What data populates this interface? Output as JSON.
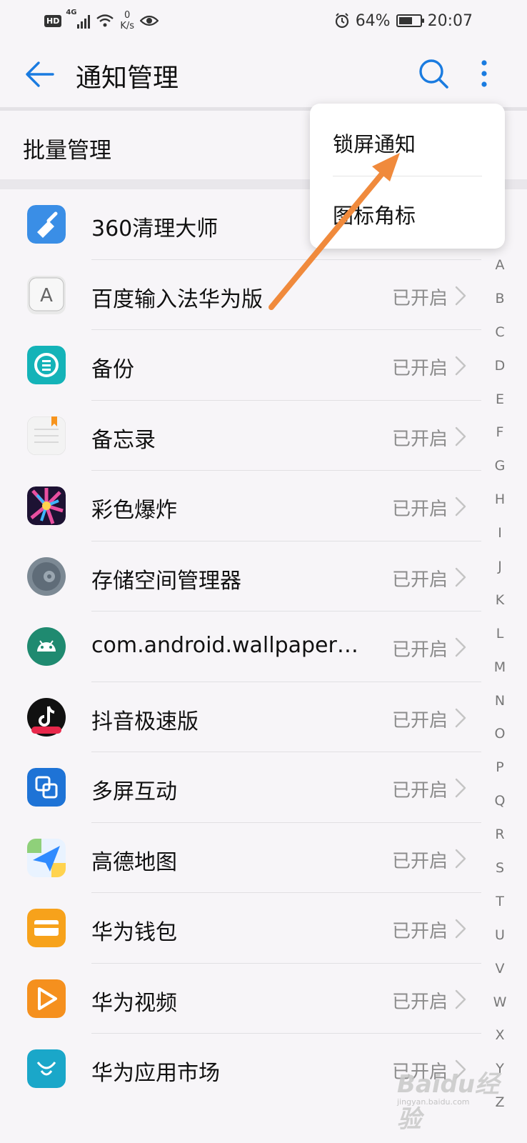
{
  "status_bar": {
    "hd": "HD",
    "network": "4G",
    "speed_value": "0",
    "speed_unit": "K/s",
    "battery_percent": "64%",
    "battery_level": 0.64,
    "time": "20:07"
  },
  "header": {
    "title": "通知管理"
  },
  "batch_label": "批量管理",
  "popup_menu": {
    "items": [
      "锁屏通知",
      "图标角标"
    ]
  },
  "apps": [
    {
      "name": "360清理大师",
      "status": "",
      "icon": "broom-icon",
      "color": "#3a8ee6"
    },
    {
      "name": "百度输入法华为版",
      "status": "已开启",
      "icon": "keyboard-a-icon",
      "color": "#d6d6d6"
    },
    {
      "name": "备份",
      "status": "已开启",
      "icon": "backup-icon",
      "color": "#14b3b8"
    },
    {
      "name": "备忘录",
      "status": "已开启",
      "icon": "notepad-icon",
      "color": "#f0f0f0"
    },
    {
      "name": "彩色爆炸",
      "status": "已开启",
      "icon": "color-burst-icon",
      "color": "#3b1f57"
    },
    {
      "name": "存储空间管理器",
      "status": "已开启",
      "icon": "storage-gear-icon",
      "color": "#6a7885"
    },
    {
      "name": "com.android.wallpaperbac…",
      "status": "已开启",
      "icon": "android-robot-icon",
      "color": "#1f8a70"
    },
    {
      "name": "抖音极速版",
      "status": "已开启",
      "icon": "tiktok-icon",
      "color": "#111111"
    },
    {
      "name": "多屏互动",
      "status": "已开启",
      "icon": "multiscreen-icon",
      "color": "#1e73d6"
    },
    {
      "name": "高德地图",
      "status": "已开启",
      "icon": "map-navigation-icon",
      "color": "#2f8bff"
    },
    {
      "name": "华为钱包",
      "status": "已开启",
      "icon": "wallet-icon",
      "color": "#f7a21b"
    },
    {
      "name": "华为视频",
      "status": "已开启",
      "icon": "video-play-icon",
      "color": "#f5901e"
    },
    {
      "name": "华为应用市场",
      "status": "已开启",
      "icon": "app-market-icon",
      "color": "#1aa7c9"
    }
  ],
  "alphabet": [
    "A",
    "B",
    "C",
    "D",
    "E",
    "F",
    "G",
    "H",
    "I",
    "J",
    "K",
    "L",
    "M",
    "N",
    "O",
    "P",
    "Q",
    "R",
    "S",
    "T",
    "U",
    "V",
    "W",
    "X",
    "Y",
    "Z"
  ],
  "watermark": {
    "brand": "Baidu经验",
    "domain": "jingyan.baidu.com"
  },
  "colors": {
    "accent": "#1a7be0",
    "annotation_arrow": "#f08a3c",
    "status_text": "#8c8c8c"
  }
}
